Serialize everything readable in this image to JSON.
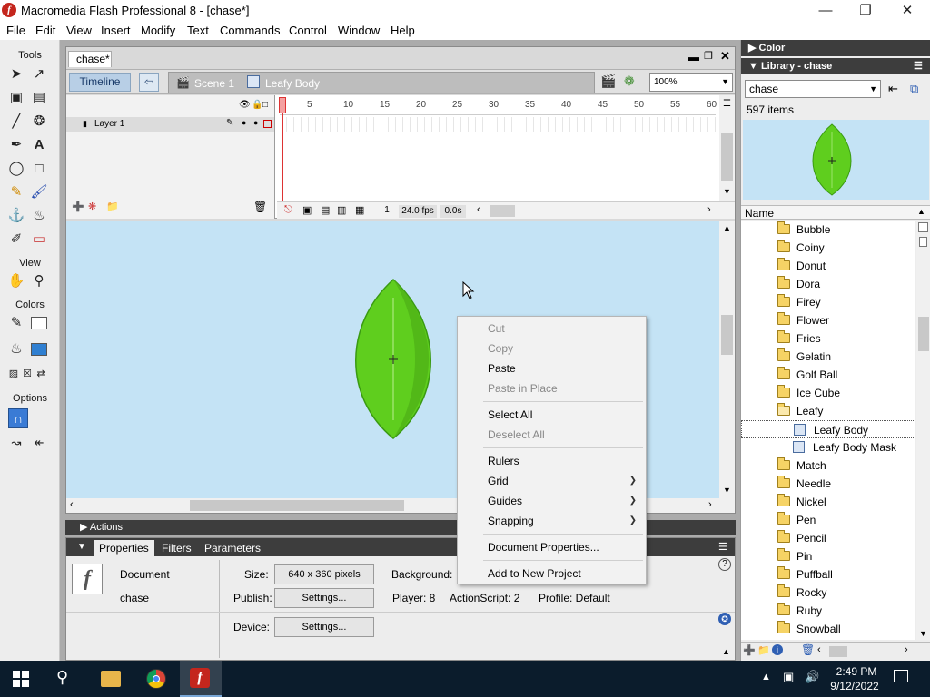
{
  "window": {
    "title": "Macromedia Flash Professional 8 - [chase*]",
    "logo_letter": "f"
  },
  "menubar": [
    "File",
    "Edit",
    "View",
    "Insert",
    "Modify",
    "Text",
    "Commands",
    "Control",
    "Window",
    "Help"
  ],
  "tools": {
    "header": "Tools",
    "view_label": "View",
    "colors_label": "Colors",
    "options_label": "Options"
  },
  "document": {
    "tab": "chase*",
    "timeline_button": "Timeline",
    "scene": "Scene 1",
    "symbol": "Leafy Body",
    "zoom": "100%",
    "layer": "Layer 1",
    "frame_numbers": [
      "5",
      "10",
      "15",
      "20",
      "25",
      "30",
      "35",
      "40",
      "45",
      "50",
      "55",
      "60"
    ],
    "current_frame": "1",
    "fps": "24.0 fps",
    "time": "0.0s"
  },
  "actions_panel": {
    "title": "Actions"
  },
  "properties": {
    "tabs": [
      "Properties",
      "Filters",
      "Parameters"
    ],
    "type": "Document",
    "name": "chase",
    "size_label": "Size:",
    "size_value": "640 x 360 pixels",
    "background_label": "Background:",
    "publish_label": "Publish:",
    "settings_button": "Settings...",
    "player": "Player: 8",
    "actionscript": "ActionScript:  2",
    "profile": "Profile:  Default",
    "device_label": "Device:",
    "device_button": "Settings..."
  },
  "context_menu": {
    "items": [
      {
        "label": "Cut",
        "enabled": false
      },
      {
        "label": "Copy",
        "enabled": false
      },
      {
        "label": "Paste",
        "enabled": true
      },
      {
        "label": "Paste in Place",
        "enabled": false
      },
      {
        "label": "Select All",
        "enabled": true
      },
      {
        "label": "Deselect All",
        "enabled": false
      },
      {
        "label": "Rulers",
        "enabled": true
      },
      {
        "label": "Grid",
        "enabled": true,
        "submenu": true
      },
      {
        "label": "Guides",
        "enabled": true,
        "submenu": true
      },
      {
        "label": "Snapping",
        "enabled": true,
        "submenu": true
      },
      {
        "label": "Document Properties...",
        "enabled": true
      },
      {
        "label": "Add to New Project",
        "enabled": true
      }
    ]
  },
  "color_panel": {
    "title": "Color"
  },
  "library": {
    "title": "Library - chase",
    "dropdown": "chase",
    "count": "597 items",
    "column": "Name",
    "items": [
      {
        "name": "Bubble",
        "kind": "folder"
      },
      {
        "name": "Coiny",
        "kind": "folder"
      },
      {
        "name": "Donut",
        "kind": "folder"
      },
      {
        "name": "Dora",
        "kind": "folder"
      },
      {
        "name": "Firey",
        "kind": "folder"
      },
      {
        "name": "Flower",
        "kind": "folder"
      },
      {
        "name": "Fries",
        "kind": "folder"
      },
      {
        "name": "Gelatin",
        "kind": "folder"
      },
      {
        "name": "Golf Ball",
        "kind": "folder"
      },
      {
        "name": "Ice Cube",
        "kind": "folder"
      },
      {
        "name": "Leafy",
        "kind": "open-folder"
      },
      {
        "name": "Leafy Body",
        "kind": "symbol",
        "selected": true
      },
      {
        "name": "Leafy Body Mask",
        "kind": "symbol"
      },
      {
        "name": "Match",
        "kind": "folder"
      },
      {
        "name": "Needle",
        "kind": "folder"
      },
      {
        "name": "Nickel",
        "kind": "folder"
      },
      {
        "name": "Pen",
        "kind": "folder"
      },
      {
        "name": "Pencil",
        "kind": "folder"
      },
      {
        "name": "Pin",
        "kind": "folder"
      },
      {
        "name": "Puffball",
        "kind": "folder"
      },
      {
        "name": "Rocky",
        "kind": "folder"
      },
      {
        "name": "Ruby",
        "kind": "folder"
      },
      {
        "name": "Snowball",
        "kind": "folder"
      }
    ]
  },
  "taskbar": {
    "time": "2:49 PM",
    "date": "9/12/2022"
  },
  "colors": {
    "leaf": "#5fce1e",
    "stage": "#c4e3f5",
    "accent": "#2f7fd1"
  }
}
